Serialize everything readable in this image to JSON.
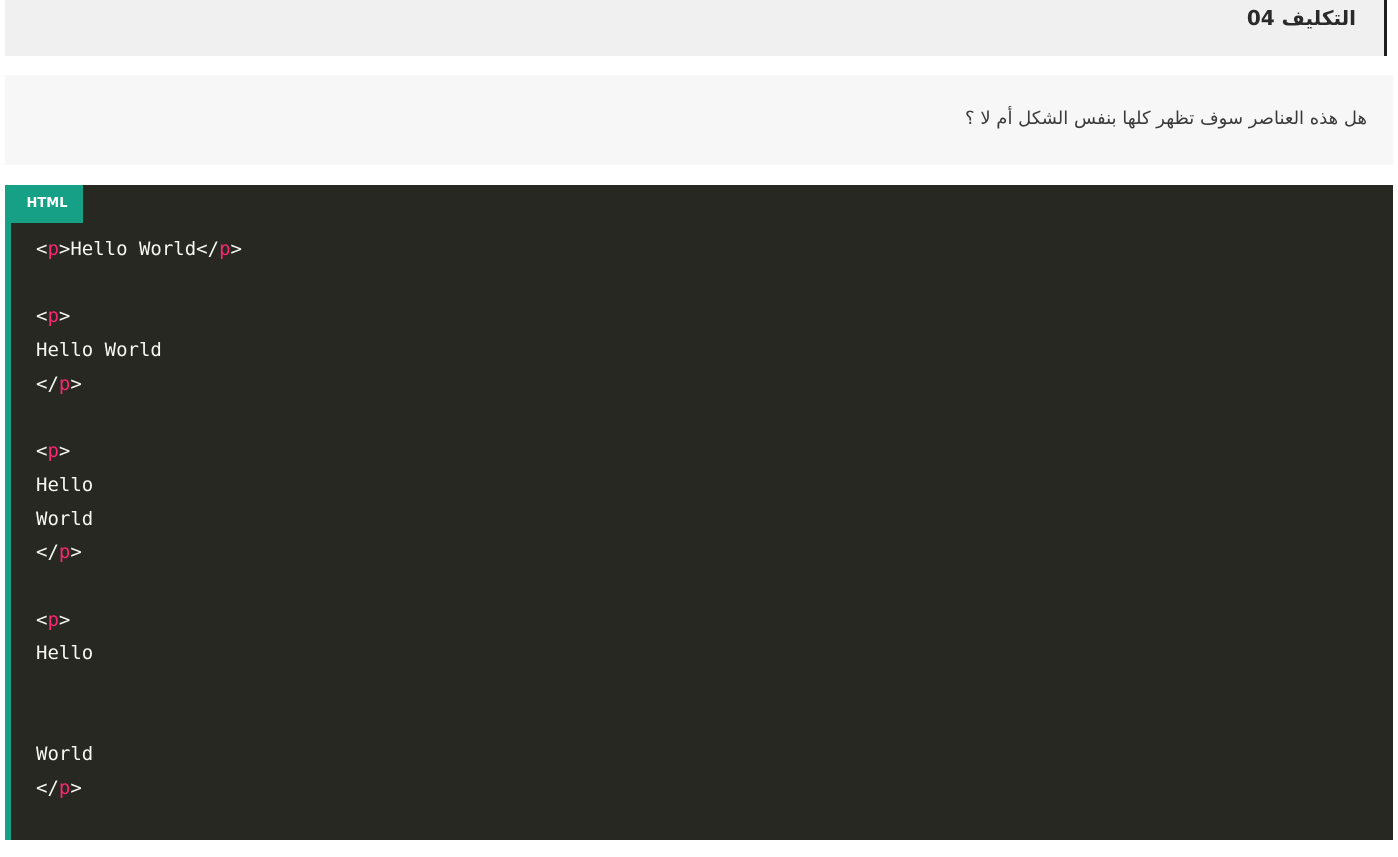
{
  "header": {
    "title": "التكليف 04"
  },
  "question": {
    "text": "هل هذه العناصر سوف تظهر كلها بنفس الشكل أم لا ؟"
  },
  "code_block": {
    "language": "HTML",
    "lines": [
      [
        {
          "t": "<"
        },
        {
          "t": "p",
          "tag": true
        },
        {
          "t": ">Hello World</"
        },
        {
          "t": "p",
          "tag": true
        },
        {
          "t": ">"
        }
      ],
      [],
      [
        {
          "t": "<"
        },
        {
          "t": "p",
          "tag": true
        },
        {
          "t": ">"
        }
      ],
      [
        {
          "t": "Hello World"
        }
      ],
      [
        {
          "t": "</"
        },
        {
          "t": "p",
          "tag": true
        },
        {
          "t": ">"
        }
      ],
      [],
      [
        {
          "t": "<"
        },
        {
          "t": "p",
          "tag": true
        },
        {
          "t": ">"
        }
      ],
      [
        {
          "t": "Hello"
        }
      ],
      [
        {
          "t": "World"
        }
      ],
      [
        {
          "t": "</"
        },
        {
          "t": "p",
          "tag": true
        },
        {
          "t": ">"
        }
      ],
      [],
      [
        {
          "t": "<"
        },
        {
          "t": "p",
          "tag": true
        },
        {
          "t": ">"
        }
      ],
      [
        {
          "t": "Hello"
        }
      ],
      [],
      [],
      [
        {
          "t": "World"
        }
      ],
      [
        {
          "t": "</"
        },
        {
          "t": "p",
          "tag": true
        },
        {
          "t": ">"
        }
      ]
    ]
  },
  "colors": {
    "code_background": "#272822",
    "accent": "#16a085",
    "tag_name": "#f92672",
    "code_text": "#f8f8f2"
  }
}
